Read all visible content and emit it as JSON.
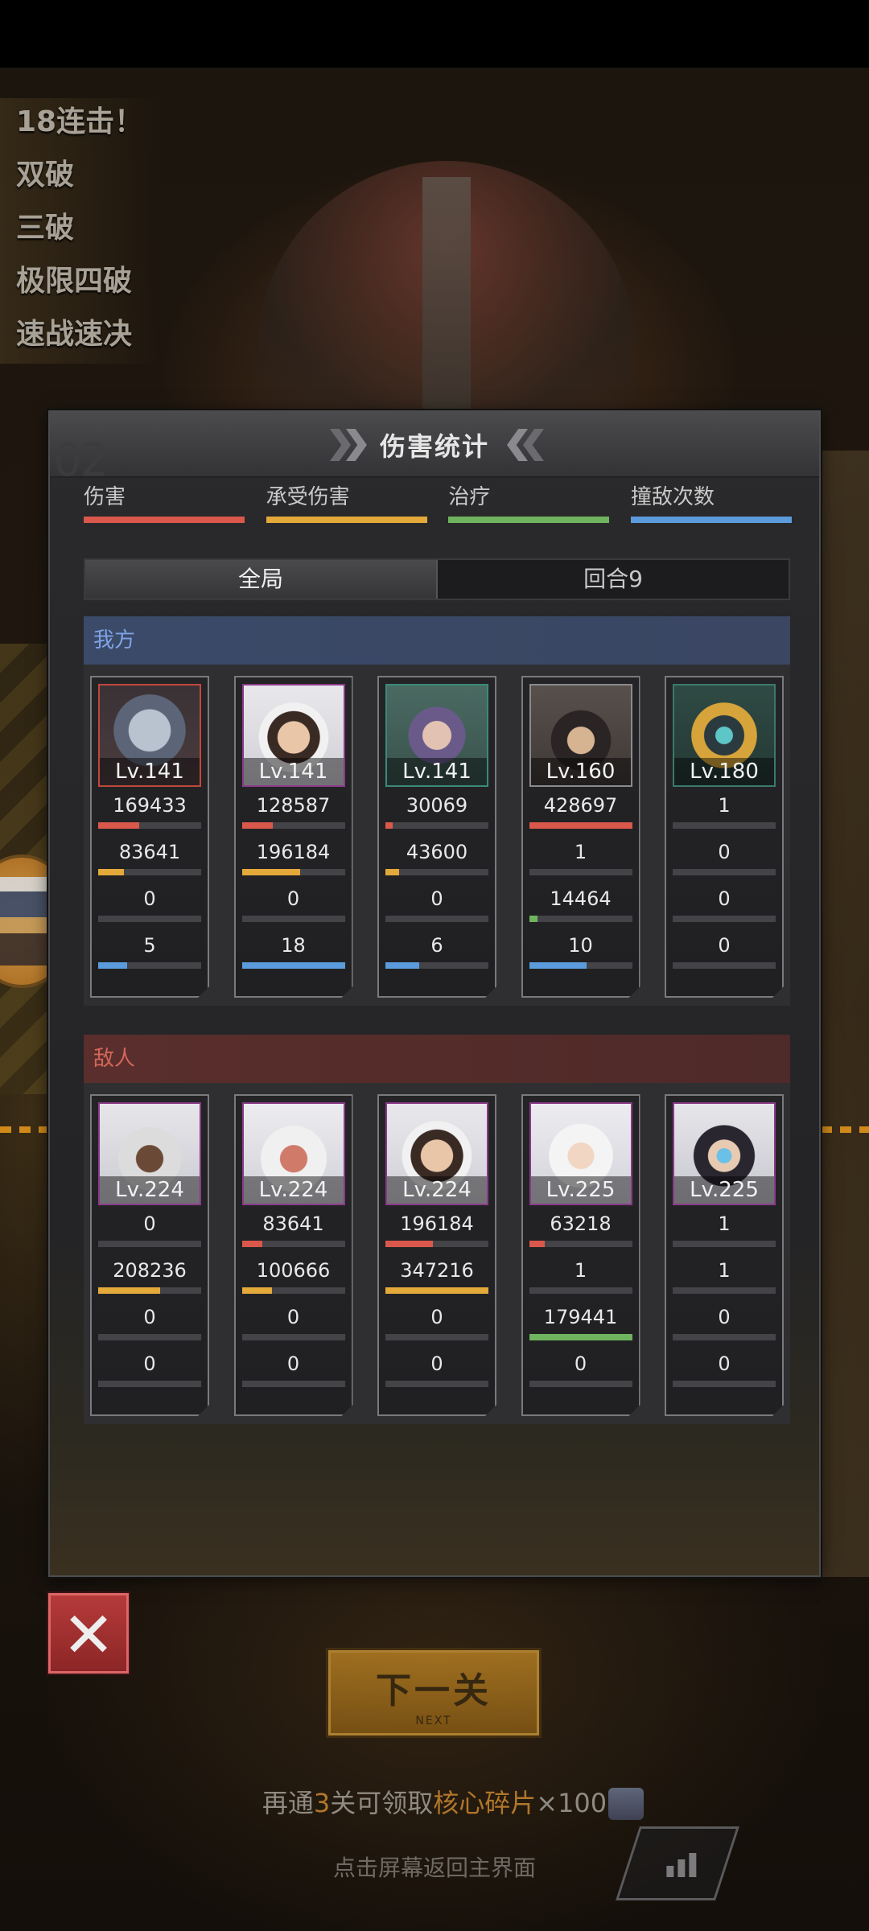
{
  "combos": [
    "18连击！",
    "双破",
    "三破",
    "极限四破",
    "速战速决"
  ],
  "panel": {
    "title": "伤害统计",
    "legend": [
      {
        "label": "伤害",
        "color": "#d9584b"
      },
      {
        "label": "承受伤害",
        "color": "#e3a93a"
      },
      {
        "label": "治疗",
        "color": "#6fb35f"
      },
      {
        "label": "撞敌次数",
        "color": "#5b9bdc"
      }
    ],
    "tabs": [
      {
        "label": "全局",
        "active": true
      },
      {
        "label": "回合9",
        "active": false
      }
    ],
    "allies": {
      "title": "我方",
      "cards": [
        {
          "level": "Lv.141",
          "damage": "169433",
          "taken": "83641",
          "heal": "0",
          "hits": "5",
          "bars": [
            0.4,
            0.25,
            0,
            0.28
          ],
          "frame": "#c0473c",
          "art": "wolf"
        },
        {
          "level": "Lv.141",
          "damage": "128587",
          "taken": "196184",
          "heal": "0",
          "hits": "18",
          "bars": [
            0.3,
            0.57,
            0,
            1.0
          ],
          "frame": "#8a3a8a",
          "art": "bunny"
        },
        {
          "level": "Lv.141",
          "damage": "30069",
          "taken": "43600",
          "heal": "0",
          "hits": "6",
          "bars": [
            0.07,
            0.13,
            0,
            0.33
          ],
          "frame": "#3a8a7a",
          "art": "maid"
        },
        {
          "level": "Lv.160",
          "damage": "428697",
          "taken": "1",
          "heal": "14464",
          "hits": "10",
          "bars": [
            1.0,
            0,
            0.08,
            0.56
          ],
          "frame": "#8a8a8e",
          "art": "horned"
        },
        {
          "level": "Lv.180",
          "damage": "1",
          "taken": "0",
          "heal": "0",
          "hits": "0",
          "bars": [
            0,
            0,
            0,
            0
          ],
          "frame": "#3a7a6a",
          "art": "pharaoh"
        }
      ]
    },
    "enemies": {
      "title": "敌人",
      "cards": [
        {
          "level": "Lv.224",
          "damage": "0",
          "taken": "208236",
          "heal": "0",
          "hits": "0",
          "bars": [
            0,
            0.6,
            0,
            0
          ],
          "frame": "#8a3a8a",
          "art": "hooded-dark"
        },
        {
          "level": "Lv.224",
          "damage": "83641",
          "taken": "100666",
          "heal": "0",
          "hits": "0",
          "bars": [
            0.2,
            0.29,
            0,
            0
          ],
          "frame": "#8a3a8a",
          "art": "hooded-red"
        },
        {
          "level": "Lv.224",
          "damage": "196184",
          "taken": "347216",
          "heal": "0",
          "hits": "0",
          "bars": [
            0.46,
            1.0,
            0,
            0
          ],
          "frame": "#8a3a8a",
          "art": "bunny"
        },
        {
          "level": "Lv.225",
          "damage": "63218",
          "taken": "1",
          "heal": "179441",
          "hits": "0",
          "bars": [
            0.15,
            0,
            1.0,
            0
          ],
          "frame": "#8a3a8a",
          "art": "white-hair"
        },
        {
          "level": "Lv.225",
          "damage": "1",
          "taken": "1",
          "heal": "0",
          "hits": "0",
          "bars": [
            0,
            0,
            0,
            0
          ],
          "frame": "#8a3a8a",
          "art": "horned-blue"
        }
      ]
    }
  },
  "buttons": {
    "close": "✕",
    "next_main": "下一关",
    "next_sub": "NEXT"
  },
  "reward": {
    "prefix": "再通",
    "num": "3",
    "middle": "关可领取",
    "item": "核心碎片",
    "suffix": "×100"
  },
  "return_hint": "点击屏幕返回主界面"
}
